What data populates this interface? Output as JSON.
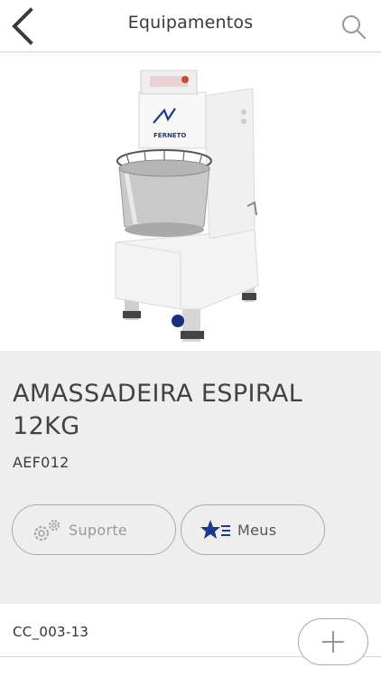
{
  "header": {
    "title": "Equipamentos",
    "back_icon": "chevron-left-icon",
    "search_icon": "search-icon"
  },
  "product": {
    "name": "AMASSADEIRA ESPIRAL 12KG",
    "code": "AEF012",
    "brand_logo_text": "FERNETO",
    "image_indicator_color": "#1b2f80"
  },
  "actions": {
    "support_label": "Suporte",
    "support_icon": "gears-icon",
    "mine_label": "Meus",
    "mine_icon": "star-list-icon"
  },
  "footer": {
    "serial": "CC_003-13",
    "add_icon": "plus-icon"
  },
  "colors": {
    "accent": "#1b3a8c",
    "info_background": "#eeeeee"
  }
}
